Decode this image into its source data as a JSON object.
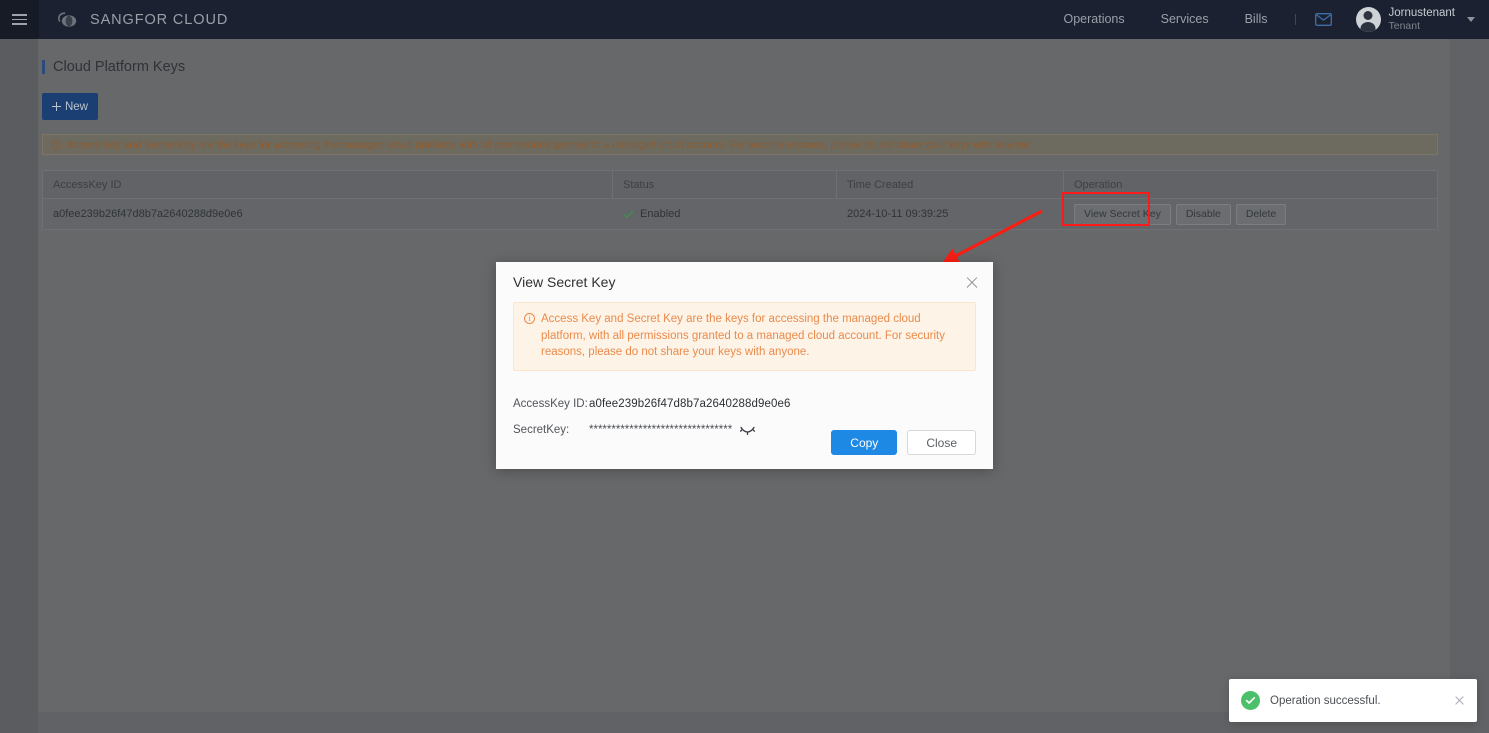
{
  "header": {
    "menu_icon": "hamburger-icon",
    "brand": "SANGFOR CLOUD",
    "nav": [
      {
        "label": "Operations"
      },
      {
        "label": "Services"
      },
      {
        "label": "Bills"
      }
    ],
    "mail_icon": "mail-icon",
    "user": {
      "name": "Jornustenant",
      "role": "Tenant"
    }
  },
  "page": {
    "title": "Cloud Platform Keys",
    "new_button": "New",
    "warning": "Access Key and Secret Key are the keys for accessing the managed cloud platform, with all permissions granted to a managed cloud account. For security reasons, please do not share your keys with anyone."
  },
  "table": {
    "columns": [
      "AccessKey ID",
      "Status",
      "Time Created",
      "Operation"
    ],
    "rows": [
      {
        "accesskey_id": "a0fee239b26f47d8b7a2640288d9e0e6",
        "status": "Enabled",
        "time_created": "2024-10-11 09:39:25",
        "operations": [
          "View Secret Key",
          "Disable",
          "Delete"
        ]
      }
    ]
  },
  "modal": {
    "title": "View Secret Key",
    "alert": "Access Key and Secret Key are the keys for accessing the managed cloud platform, with all permissions granted to a managed cloud account. For security reasons, please do not share your keys with anyone.",
    "fields": [
      {
        "label": "AccessKey ID:",
        "value": "a0fee239b26f47d8b7a2640288d9e0e6"
      },
      {
        "label": "SecretKey:",
        "value": "********************************"
      }
    ],
    "reveal_icon": "eye-icon",
    "copy_button": "Copy",
    "close_button": "Close"
  },
  "toast": {
    "message": "Operation successful.",
    "icon": "check-circle-icon"
  },
  "colors": {
    "header_bg": "#1b2130",
    "primary_blue": "#1e88e5",
    "new_button_blue": "#1c3f73",
    "alert_orange": "#ea8b4d",
    "alert_bg": "#fdf3e6",
    "success_green": "#4cbf6a",
    "annotation_red": "#ff1a1a"
  }
}
